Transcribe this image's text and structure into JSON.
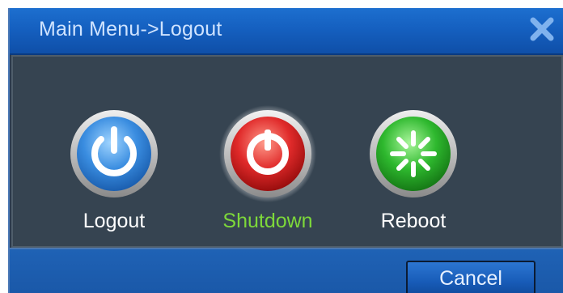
{
  "window": {
    "title": "Main Menu->Logout",
    "close_icon": "close-icon"
  },
  "actions": [
    {
      "label": "Logout",
      "icon": "power-icon",
      "color": "#3a8de0",
      "selected": false
    },
    {
      "label": "Shutdown",
      "icon": "shutdown-icon",
      "color": "#e02a2a",
      "selected": true
    },
    {
      "label": "Reboot",
      "icon": "reboot-icon",
      "color": "#2eb82e",
      "selected": false
    }
  ],
  "footer": {
    "cancel_label": "Cancel"
  },
  "colors": {
    "titlebar": "#1560c0",
    "panel": "#364451",
    "selected_label": "#7dd83a"
  }
}
